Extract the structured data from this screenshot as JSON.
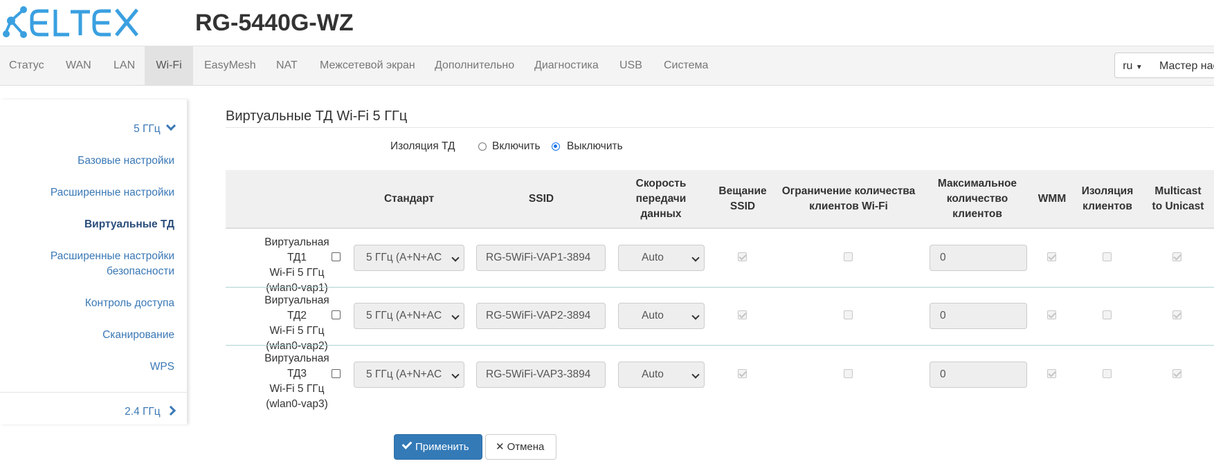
{
  "brand": {
    "logo_text": "ELTEX",
    "model": "RG-5440G-WZ"
  },
  "nav": {
    "items": [
      "Статус",
      "WAN",
      "LAN",
      "Wi-Fi",
      "EasyMesh",
      "NAT",
      "Межсетевой экран",
      "Дополнительно",
      "Диагностика",
      "USB",
      "Система"
    ],
    "active": "Wi-Fi",
    "lang": "ru",
    "wizard": "Мастер нас"
  },
  "sidebar": {
    "band_5": "5 ГГц",
    "items": [
      "Базовые настройки",
      "Расширенные настройки",
      "Виртуальные ТД",
      "Расширенные настройки безопасности",
      "Контроль доступа",
      "Сканирование",
      "WPS"
    ],
    "active": "Виртуальные ТД",
    "band_24": "2.4 ГГц"
  },
  "page": {
    "title": "Виртуальные ТД Wi-Fi 5 ГГц",
    "isolation_label": "Изоляция ТД",
    "radio_on": "Включить",
    "radio_off": "Выключить",
    "isolation_selected": "Выключить"
  },
  "table": {
    "headers": {
      "standard": "Стандарт",
      "ssid": "SSID",
      "rate": "Скорость передачи данных",
      "broadcast": "Вещание SSID",
      "client_limit": "Ограничение количества клиентов Wi-Fi",
      "max_clients": "Максимальное количество клиентов",
      "wmm": "WMM",
      "client_isolation": "Изоляция клиентов",
      "multicast": "Multicast to Unicast"
    },
    "rows": [
      {
        "name": "Виртуальная ТД1",
        "band": "Wi-Fi 5 ГГц",
        "iface": "(wlan0-vap1)",
        "standard": "5 ГГц (A+N+AC",
        "ssid": "RG-5WiFi-VAP1-3894",
        "rate": "Auto",
        "max_clients": "0"
      },
      {
        "name": "Виртуальная ТД2",
        "band": "Wi-Fi 5 ГГц",
        "iface": "(wlan0-vap2)",
        "standard": "5 ГГц (A+N+AC",
        "ssid": "RG-5WiFi-VAP2-3894",
        "rate": "Auto",
        "max_clients": "0"
      },
      {
        "name": "Виртуальная ТД3",
        "band": "Wi-Fi 5 ГГц",
        "iface": "(wlan0-vap3)",
        "standard": "5 ГГц (A+N+AC",
        "ssid": "RG-5WiFi-VAP3-3894",
        "rate": "Auto",
        "max_clients": "0"
      }
    ]
  },
  "buttons": {
    "apply": "Применить",
    "cancel": "Отмена"
  },
  "colors": {
    "brand_blue": "#3aa0e0",
    "link": "#3a78b5",
    "primary_button": "#337ab7"
  }
}
